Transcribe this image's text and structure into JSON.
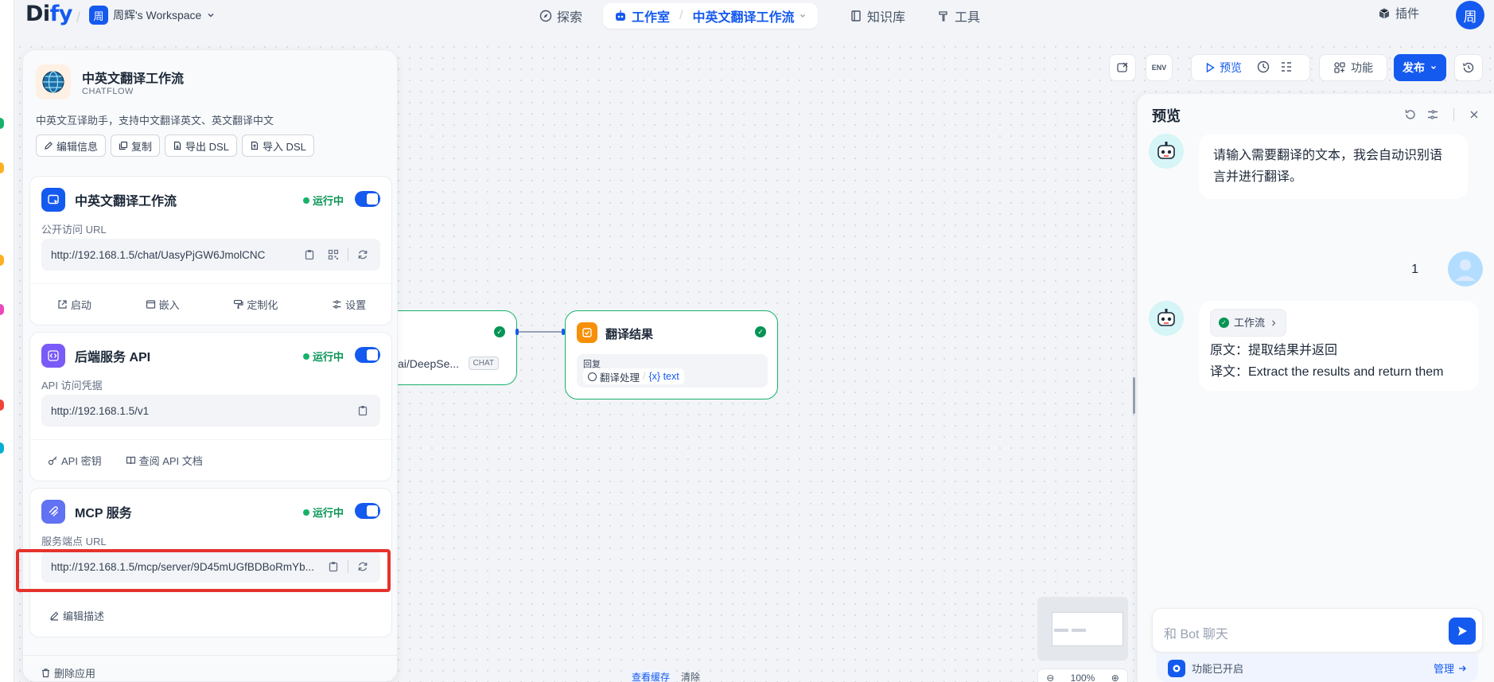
{
  "topbar": {
    "logo_prefix": "Di",
    "logo_suffix": "fy",
    "workspace_avatar": "周",
    "workspace_name": "周辉's Workspace",
    "nav": [
      {
        "label": "探索",
        "icon": "compass-icon"
      },
      {
        "label": "工作室",
        "icon": "robot-icon"
      },
      {
        "label": "知识库",
        "icon": "book-icon"
      },
      {
        "label": "工具",
        "icon": "hammer-icon"
      }
    ],
    "breadcrumb_app": "中英文翻译工作流",
    "plugins_label": "插件",
    "user_avatar": "周"
  },
  "toolbar": {
    "env_label": "ENV",
    "preview_label": "预览",
    "features_label": "功能",
    "publish_label": "发布"
  },
  "app": {
    "name": "中英文翻译工作流",
    "type": "CHATFLOW",
    "description": "中英文互译助手，支持中文翻译英文、英文翻译中文",
    "actions": [
      "编辑信息",
      "复制",
      "导出 DSL",
      "导入 DSL"
    ]
  },
  "webapp": {
    "title": "中英文翻译工作流",
    "status": "运行中",
    "url_label": "公开访问 URL",
    "url": "http://192.168.1.5/chat/UasyPjGW6JmolCNC",
    "actions": [
      "启动",
      "嵌入",
      "定制化",
      "设置"
    ]
  },
  "api": {
    "title": "后端服务 API",
    "status": "运行中",
    "url_label": "API 访问凭据",
    "url": "http://192.168.1.5/v1",
    "actions": [
      "API 密钥",
      "查阅 API 文档"
    ]
  },
  "mcp": {
    "title": "MCP 服务",
    "status": "运行中",
    "url_label": "服务端点 URL",
    "url": "http://192.168.1.5/mcp/server/9D45mUGfBDBoRmYb...",
    "edit_label": "编辑描述"
  },
  "panel_footer": {
    "delete_label": "删除应用"
  },
  "nodes": {
    "llm_model": "ai/DeepSe...",
    "llm_badge": "CHAT",
    "answer_title": "翻译结果",
    "answer_field": "回复",
    "answer_source": "翻译处理",
    "answer_var": "{x} text"
  },
  "canvas_footer": {
    "view_cache": "查看缓存",
    "clear": "清除",
    "zoom": "100%"
  },
  "preview": {
    "title": "预览",
    "bot_greeting": "请输入需要翻译的文本，我会自动识别语言并进行翻译。",
    "user_message": "1",
    "workflow_tag": "工作流",
    "reply_line1": "原文：提取结果并返回",
    "reply_line2": "译文：Extract the results and return them",
    "input_placeholder": "和 Bot 聊天",
    "features_enabled": "功能已开启",
    "manage_label": "管理"
  },
  "colors": {
    "accent": "#155aef",
    "success": "#17b26a",
    "highlight_border": "#e5322c"
  }
}
